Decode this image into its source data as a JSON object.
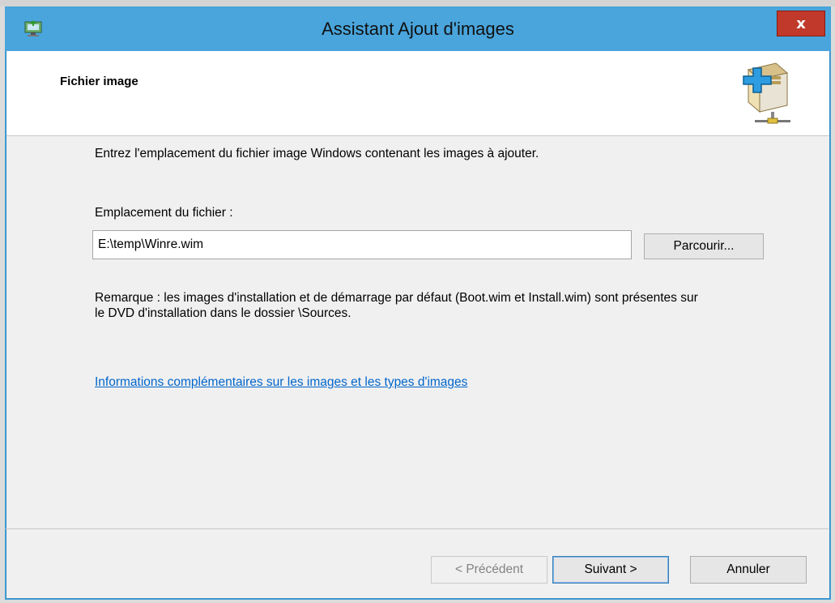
{
  "window": {
    "title": "Assistant Ajout d'images",
    "close_glyph": "x"
  },
  "header": {
    "title": "Fichier image",
    "icon": "image-add-box-icon"
  },
  "content": {
    "instruction": "Entrez l'emplacement du fichier image Windows contenant les images à ajouter.",
    "location_label": "Emplacement du fichier :",
    "location_value": "E:\\temp\\Winre.wim",
    "browse_label": "Parcourir...",
    "remark": "Remarque : les images d'installation et de démarrage par défaut (Boot.wim et Install.wim) sont présentes sur le DVD d'installation dans le dossier \\Sources.",
    "info_link": "Informations complémentaires sur les images et les types d'images"
  },
  "footer": {
    "prev_label": "< Précédent",
    "next_label": "Suivant >",
    "cancel_label": "Annuler"
  },
  "colors": {
    "titlebar": "#49a5dc",
    "close": "#c0392b",
    "link": "#0066cc"
  }
}
